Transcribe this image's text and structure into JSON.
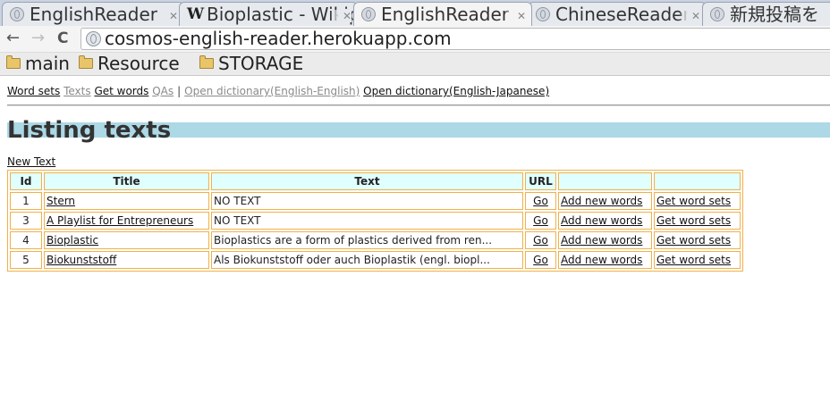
{
  "browser": {
    "tabs": [
      {
        "title": "EnglishReader",
        "icon": "globe-icon",
        "active": false
      },
      {
        "title": "Bioplastic - Wikipedia",
        "icon": "wikipedia-icon",
        "active": false
      },
      {
        "title": "EnglishReader",
        "icon": "globe-icon",
        "active": true
      },
      {
        "title": "ChineseReader",
        "icon": "globe-icon",
        "active": false
      },
      {
        "title": "新規投稿を",
        "icon": "globe-icon",
        "active": false
      }
    ],
    "back_glyph": "←",
    "forward_glyph": "→",
    "reload_glyph": "C",
    "address": "cosmos-english-reader.herokuapp.com",
    "bookmarks": [
      {
        "label": "main"
      },
      {
        "label": "Resource"
      },
      {
        "label": "STORAGE"
      }
    ]
  },
  "nav": {
    "word_sets": "Word sets",
    "texts": "Texts",
    "get_words": "Get words",
    "qas": "QAs",
    "separator": "|",
    "dict_en_en": "Open dictionary(English-English)",
    "dict_en_ja": "Open dictionary(English-Japanese)"
  },
  "page": {
    "title": "Listing texts",
    "new_text": "New Text",
    "accent_color": "#add8e6",
    "table_border_color": "#f0b14a",
    "header_bg_color": "#e0ffff"
  },
  "table": {
    "headers": {
      "id": "Id",
      "title": "Title",
      "text": "Text",
      "url": "URL",
      "col5": "",
      "col6": ""
    },
    "rows": [
      {
        "id": "1",
        "title": "Stern",
        "text": "NO TEXT",
        "url": "Go",
        "add": "Add new words",
        "get": "Get word sets"
      },
      {
        "id": "3",
        "title": "A Playlist for Entrepreneurs",
        "text": "NO TEXT",
        "url": "Go",
        "add": "Add new words",
        "get": "Get word sets"
      },
      {
        "id": "4",
        "title": "Bioplastic",
        "text": "Bioplastics are a form of plastics derived from ren...",
        "url": "Go",
        "add": "Add new words",
        "get": "Get word sets"
      },
      {
        "id": "5",
        "title": "Biokunststoff",
        "text": "Als Biokunststoff oder auch Bioplastik (engl. biopl...",
        "url": "Go",
        "add": "Add new words",
        "get": "Get word sets"
      }
    ]
  }
}
